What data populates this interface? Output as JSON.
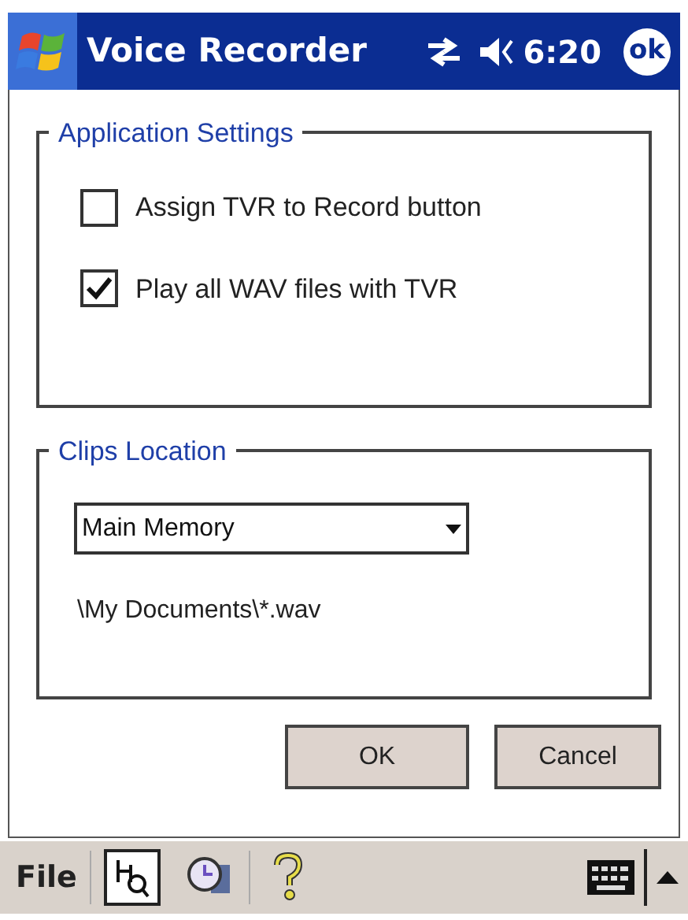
{
  "title_bar": {
    "title": "Voice Recorder",
    "time": "6:20",
    "ok_label": "ok"
  },
  "application_settings": {
    "legend": "Application Settings",
    "options": [
      {
        "label": "Assign TVR to Record button",
        "checked": false
      },
      {
        "label": "Play all WAV files with TVR",
        "checked": true
      }
    ]
  },
  "clips_location": {
    "legend": "Clips Location",
    "dropdown": {
      "value": "Main Memory"
    },
    "path": "\\My Documents\\*.wav"
  },
  "buttons": [
    "OK",
    "Cancel"
  ],
  "menu_bar": {
    "menu": "File"
  }
}
